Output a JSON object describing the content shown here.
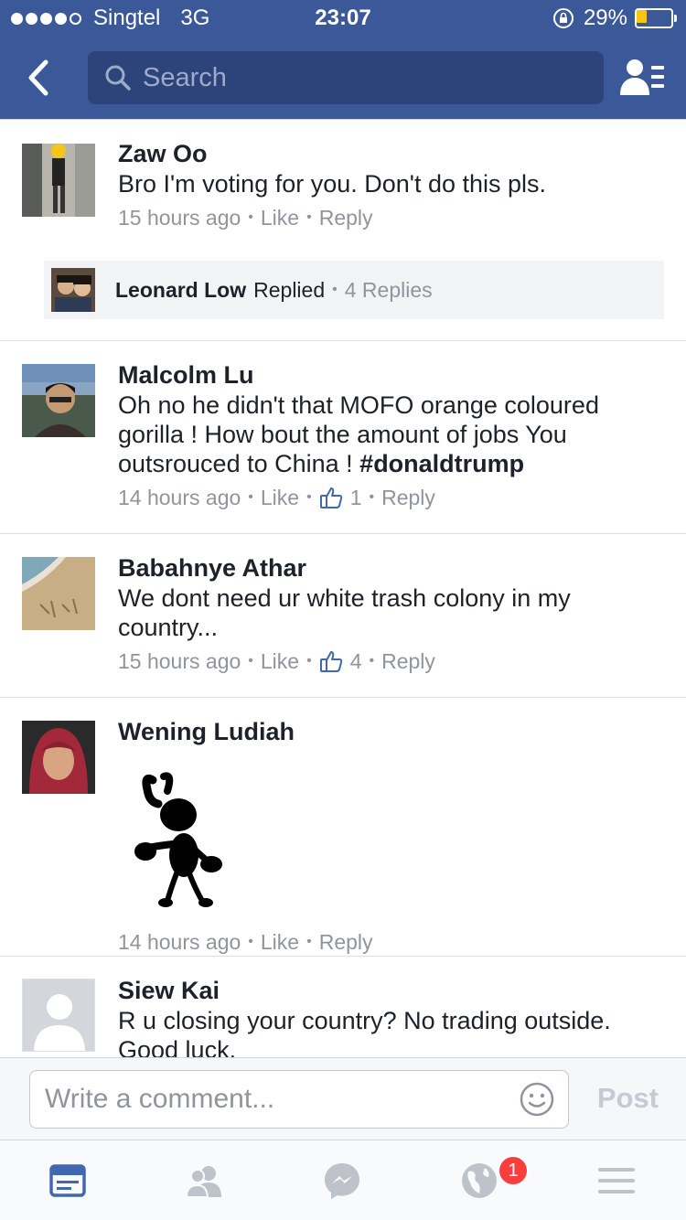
{
  "status_bar": {
    "carrier": "Singtel",
    "network": "3G",
    "time": "23:07",
    "battery_percent": "29%",
    "battery_level": 0.29,
    "signal_bars_filled": 4,
    "signal_bars_total": 5
  },
  "nav": {
    "search_placeholder": "Search"
  },
  "comments": [
    {
      "author": "Zaw Oo",
      "text": "Bro I'm voting for you. Don't do this pls.",
      "time": "15 hours ago",
      "like": "Like",
      "reply": "Reply",
      "reply_summary": {
        "name": "Leonard Low",
        "action": "Replied",
        "count": "4 Replies"
      }
    },
    {
      "author": "Malcolm Lu",
      "text": "Oh no he didn't that MOFO orange coloured gorilla ! How bout the amount of jobs You outsrouced to China ! ",
      "hashtag": "#donaldtrump",
      "time": "14 hours ago",
      "like": "Like",
      "like_count": "1",
      "reply": "Reply"
    },
    {
      "author": "Babahnye Athar",
      "text": "We dont need ur white trash colony in my country...",
      "time": "15 hours ago",
      "like": "Like",
      "like_count": "4",
      "reply": "Reply"
    },
    {
      "author": "Wening Ludiah",
      "time": "14 hours ago",
      "like": "Like",
      "reply": "Reply"
    },
    {
      "author": "Siew Kai",
      "text": "R u closing your country? No trading outside. Good luck."
    }
  ],
  "composer": {
    "placeholder": "Write a comment...",
    "post_label": "Post"
  },
  "tab_bar": {
    "notifications_badge": "1"
  },
  "colors": {
    "brand": "#3b5998",
    "badge": "#fa3e3e",
    "meta_text": "#90949c"
  }
}
